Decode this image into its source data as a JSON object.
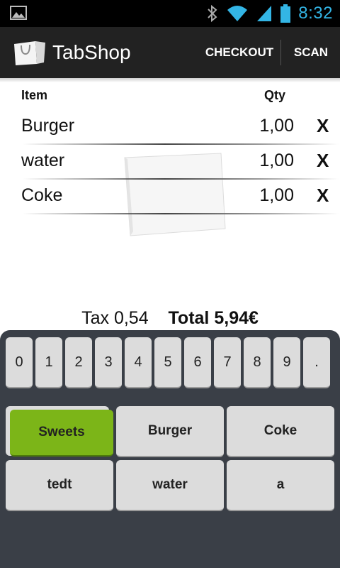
{
  "status_bar": {
    "time": "8:32",
    "icons": [
      "image-icon",
      "bluetooth-icon",
      "wifi-icon",
      "signal-icon",
      "battery-icon"
    ]
  },
  "action_bar": {
    "title": "TabShop",
    "checkout_label": "CHECKOUT",
    "scan_label": "SCAN"
  },
  "list": {
    "header_item": "Item",
    "header_qty": "Qty",
    "rows": [
      {
        "name": "Burger",
        "qty": "1,00",
        "remove": "X"
      },
      {
        "name": "water",
        "qty": "1,00",
        "remove": "X"
      },
      {
        "name": "Coke",
        "qty": "1,00",
        "remove": "X"
      }
    ]
  },
  "totals": {
    "tax_label": "Tax",
    "tax_value": "0,54",
    "total_label": "Total",
    "total_value": "5,94€"
  },
  "keypad": {
    "digits": [
      "0",
      "1",
      "2",
      "3",
      "4",
      "5",
      "6",
      "7",
      "8",
      "9",
      "."
    ]
  },
  "products": [
    "Sweets",
    "Burger",
    "Coke",
    "tedt",
    "water",
    "a"
  ],
  "colors": {
    "accent_time": "#33b5e5",
    "selected_product": "#7cb518",
    "actionbar_bg": "#222222",
    "panel_bg": "#3a3f47"
  }
}
